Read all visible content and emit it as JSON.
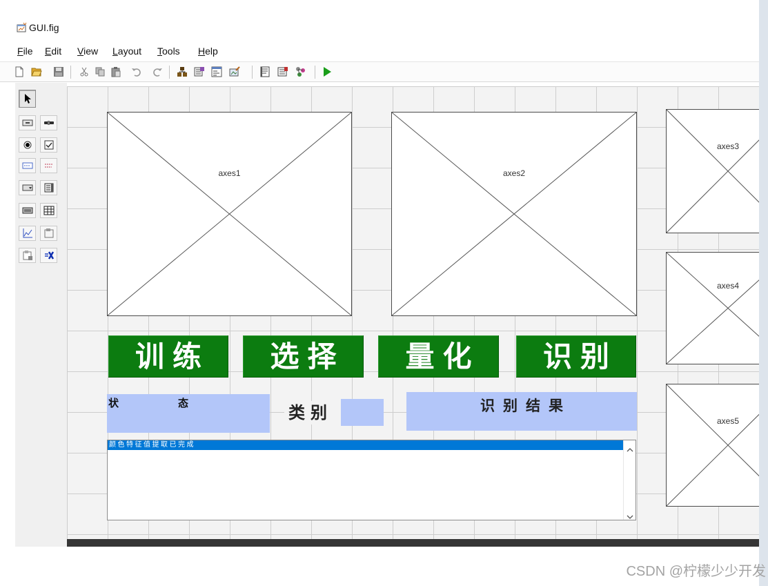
{
  "window": {
    "title": "GUI.fig"
  },
  "menu": {
    "items": [
      {
        "label": "File"
      },
      {
        "label": "Edit"
      },
      {
        "label": "View"
      },
      {
        "label": "Layout"
      },
      {
        "label": "Tools"
      },
      {
        "label": "Help"
      }
    ]
  },
  "toolbar": {
    "icons": [
      "new-file-icon",
      "open-icon",
      "save-icon",
      "cut-icon",
      "copy-icon",
      "paste-icon",
      "undo-icon",
      "redo-icon",
      "align-objects-icon",
      "menu-editor-icon",
      "tab-order-icon",
      "toolbar-editor-icon",
      "editor-icon",
      "property-inspector-icon",
      "object-browser-icon",
      "run-icon"
    ]
  },
  "palette": {
    "tools": [
      "select-icon",
      "push-button-icon",
      "slider-icon",
      "radio-button-icon",
      "checkbox-icon",
      "edit-text-icon",
      "static-text-icon",
      "popup-menu-icon",
      "listbox-icon",
      "toggle-button-icon",
      "table-icon",
      "axes-icon",
      "panel-icon",
      "button-group-icon",
      "activex-icon"
    ],
    "selected": "select-icon"
  },
  "canvas": {
    "axes": [
      {
        "label": "axes1"
      },
      {
        "label": "axes2"
      },
      {
        "label": "axes3"
      },
      {
        "label": "axes4"
      },
      {
        "label": "axes5"
      }
    ],
    "buttons": [
      {
        "label": "训练"
      },
      {
        "label": "选择"
      },
      {
        "label": "量化"
      },
      {
        "label": "识别"
      }
    ],
    "status": {
      "char_1": "状",
      "char_2": "态"
    },
    "category_label": "类别",
    "result_label": "识别结果",
    "listbox": {
      "items": [
        "颜色特征值提取已完成"
      ],
      "selected_index": 0
    }
  },
  "watermark": "CSDN @柠檬少少开发",
  "colors": {
    "button_green": "#0c7c10",
    "panel_blue": "#b3c6f9",
    "selection_blue": "#0078d7",
    "run_green": "#1a9e1a",
    "bottom_bar": "#353535"
  }
}
